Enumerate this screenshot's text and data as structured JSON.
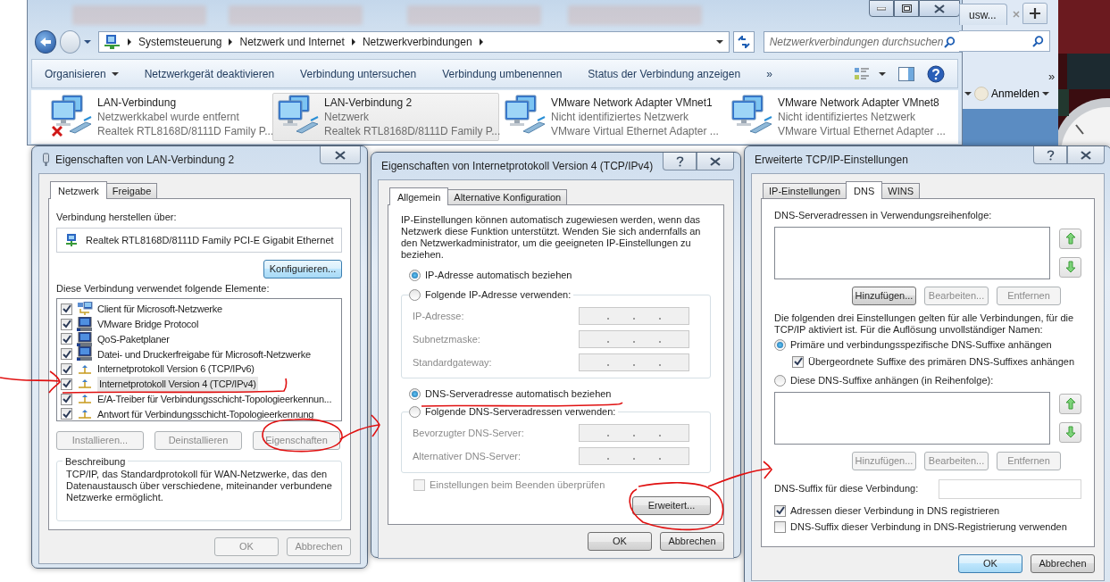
{
  "explorer": {
    "breadcrumb": [
      "Systemsteuerung",
      "Netzwerk und Internet",
      "Netzwerkverbindungen"
    ],
    "search": {
      "placeholder": "Netzwerkverbindungen durchsuchen"
    },
    "toolbar": [
      {
        "label": "Organisieren",
        "dropdown": true
      },
      {
        "label": "Netzwerkgerät deaktivieren",
        "dropdown": false
      },
      {
        "label": "Verbindung untersuchen",
        "dropdown": false
      },
      {
        "label": "Verbindung umbenennen",
        "dropdown": false
      },
      {
        "label": "Status der Verbindung anzeigen",
        "dropdown": false
      },
      {
        "label": "»",
        "dropdown": false
      }
    ],
    "connections": [
      {
        "name": "LAN-Verbindung",
        "status": "Netzwerkkabel wurde entfernt",
        "adapter": "Realtek RTL8168D/8111D Family P...",
        "disconnected": true,
        "selected": false
      },
      {
        "name": "LAN-Verbindung 2",
        "status": "Netzwerk",
        "adapter": "Realtek RTL8168D/8111D Family P...",
        "disconnected": false,
        "selected": true
      },
      {
        "name": "VMware Network Adapter VMnet1",
        "status": "Nicht identifiziertes Netzwerk",
        "adapter": "VMware Virtual Ethernet Adapter ...",
        "disconnected": false,
        "selected": false
      },
      {
        "name": "VMware Network Adapter VMnet8",
        "status": "Nicht identifiziertes Netzwerk",
        "adapter": "VMware Virtual Ethernet Adapter ...",
        "disconnected": false,
        "selected": false
      }
    ]
  },
  "browser": {
    "tab": "usw...",
    "overflow": "»",
    "account": "Anmelden"
  },
  "lan_properties": {
    "title": "Eigenschaften von LAN-Verbindung 2",
    "tabs": [
      {
        "label": "Netzwerk",
        "selected": true
      },
      {
        "label": "Freigabe",
        "selected": false
      }
    ],
    "connect_label": "Verbindung herstellen über:",
    "adapter": "Realtek RTL8168D/8111D Family PCI-E Gigabit Ethernet",
    "configure_button": {
      "label": "Konfigurieren...",
      "disabled": false,
      "focused": true
    },
    "elements_label": "Diese Verbindung verwendet folgende Elemente:",
    "elements": [
      {
        "label": "Client für Microsoft-Netzwerke",
        "kind": "client",
        "checked": true,
        "selected": false
      },
      {
        "label": "VMware Bridge Protocol",
        "kind": "service",
        "checked": true,
        "selected": false
      },
      {
        "label": "QoS-Paketplaner",
        "kind": "service",
        "checked": true,
        "selected": false
      },
      {
        "label": "Datei- und Druckerfreigabe für Microsoft-Netzwerke",
        "kind": "service",
        "checked": true,
        "selected": false
      },
      {
        "label": "Internetprotokoll Version 6 (TCP/IPv6)",
        "kind": "protocol",
        "checked": true,
        "selected": false
      },
      {
        "label": "Internetprotokoll Version 4 (TCP/IPv4)",
        "kind": "protocol",
        "checked": true,
        "selected": true
      },
      {
        "label": "E/A-Treiber für Verbindungsschicht-Topologieerkennun...",
        "kind": "protocol",
        "checked": true,
        "selected": false
      },
      {
        "label": "Antwort für Verbindungsschicht-Topologieerkennung",
        "kind": "protocol",
        "checked": true,
        "selected": false
      }
    ],
    "element_buttons": [
      {
        "label": "Installieren...",
        "disabled": true,
        "focused": false
      },
      {
        "label": "Deinstallieren",
        "disabled": true,
        "focused": false
      },
      {
        "label": "Eigenschaften",
        "disabled": true,
        "focused": false
      }
    ],
    "description": {
      "title": "Beschreibung",
      "text": "TCP/IP, das Standardprotokoll für WAN-Netzwerke, das den Datenaustausch über verschiedene, miteinander verbundene Netzwerke ermöglicht."
    },
    "buttons": [
      {
        "label": "OK",
        "disabled": true,
        "focused": false
      },
      {
        "label": "Abbrechen",
        "disabled": true,
        "focused": false
      }
    ]
  },
  "ipv4_properties": {
    "title": "Eigenschaften von Internetprotokoll Version 4 (TCP/IPv4)",
    "tabs": [
      {
        "label": "Allgemein",
        "selected": true
      },
      {
        "label": "Alternative Konfiguration",
        "selected": false
      }
    ],
    "intro": "IP-Einstellungen können automatisch zugewiesen werden, wenn das Netzwerk diese Funktion unterstützt. Wenden Sie sich andernfalls an den Netzwerkadministrator, um die geeigneten IP-Einstellungen zu beziehen.",
    "ip_options": [
      {
        "label": "IP-Adresse automatisch beziehen",
        "selected": true
      },
      {
        "label": "Folgende IP-Adresse verwenden:",
        "selected": false
      }
    ],
    "ip_fields": [
      {
        "label": "IP-Adresse:"
      },
      {
        "label": "Subnetzmaske:"
      },
      {
        "label": "Standardgateway:"
      }
    ],
    "dns_options": [
      {
        "label": "DNS-Serveradresse automatisch beziehen",
        "selected": true
      },
      {
        "label": "Folgende DNS-Serveradressen verwenden:",
        "selected": false
      }
    ],
    "dns_fields": [
      {
        "label": "Bevorzugter DNS-Server:"
      },
      {
        "label": "Alternativer DNS-Server:"
      }
    ],
    "validate": {
      "label": "Einstellungen beim Beenden überprüfen",
      "checked": false,
      "disabled": true
    },
    "advanced_button": {
      "label": "Erweitert...",
      "disabled": false,
      "focused": false
    },
    "buttons": [
      {
        "label": "OK",
        "disabled": false,
        "focused": false
      },
      {
        "label": "Abbrechen",
        "disabled": false,
        "focused": false
      }
    ]
  },
  "advanced_tcpip": {
    "title": "Erweiterte TCP/IP-Einstellungen",
    "tabs": [
      {
        "label": "IP-Einstellungen",
        "selected": false
      },
      {
        "label": "DNS",
        "selected": true
      },
      {
        "label": "WINS",
        "selected": false
      }
    ],
    "servers_label": "DNS-Serveradressen in Verwendungsreihenfolge:",
    "server_buttons": [
      {
        "label": "Hinzufügen...",
        "disabled": false,
        "focused": false
      },
      {
        "label": "Bearbeiten...",
        "disabled": true,
        "focused": false
      },
      {
        "label": "Entfernen",
        "disabled": true,
        "focused": false
      }
    ],
    "info": "Die folgenden drei Einstellungen gelten für alle Verbindungen, für die TCP/IP aktiviert ist. Für die Auflösung unvollständiger Namen:",
    "suffix_options": [
      {
        "label": "Primäre und verbindungsspezifische DNS-Suffixe anhängen",
        "selected": true
      },
      {
        "label": "Diese DNS-Suffixe anhängen (in Reihenfolge):",
        "selected": false
      }
    ],
    "parent_suffix": {
      "label": "Übergeordnete Suffixe des primären DNS-Suffixes anhängen",
      "checked": true
    },
    "suffix_buttons": [
      {
        "label": "Hinzufügen...",
        "disabled": true,
        "focused": false
      },
      {
        "label": "Bearbeiten...",
        "disabled": true,
        "focused": false
      },
      {
        "label": "Entfernen",
        "disabled": true,
        "focused": false
      }
    ],
    "connection_suffix_label": "DNS-Suffix für diese Verbindung:",
    "register": [
      {
        "label": "Adressen dieser Verbindung in DNS registrieren",
        "checked": true
      },
      {
        "label": "DNS-Suffix dieser Verbindung in DNS-Registrierung verwenden",
        "checked": false
      }
    ],
    "buttons": [
      {
        "label": "OK",
        "disabled": false,
        "focused": true
      },
      {
        "label": "Abbrechen",
        "disabled": false,
        "focused": false
      }
    ]
  }
}
